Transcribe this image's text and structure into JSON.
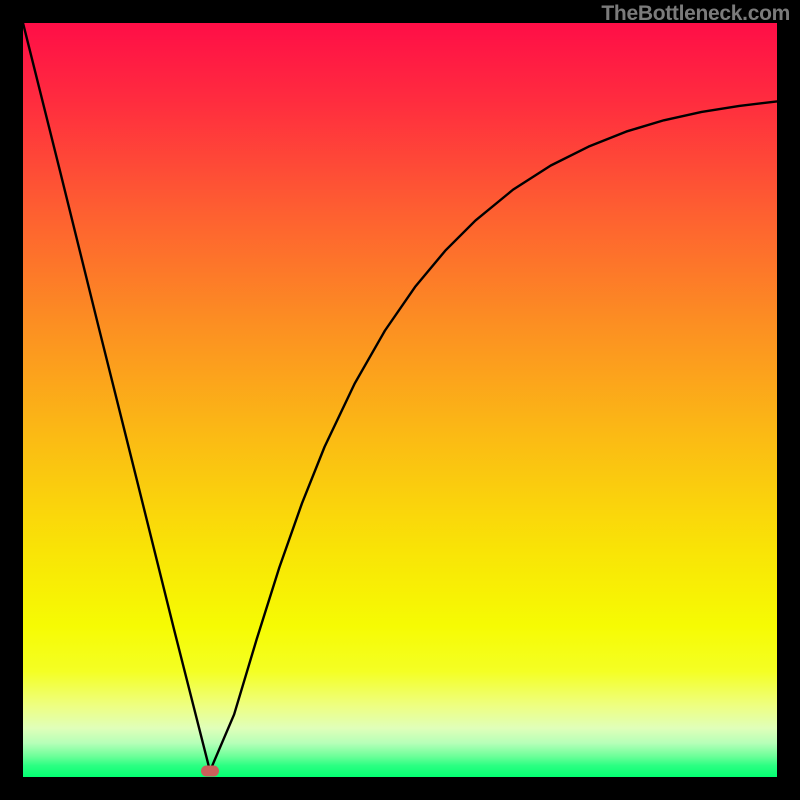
{
  "attribution": "TheBottleneck.com",
  "marker": {
    "color": "#cb5f5b",
    "cx_frac": 0.248,
    "cy_frac": 0.992
  },
  "gradient_stops": [
    {
      "offset": 0.0,
      "color": "#ff0e47"
    },
    {
      "offset": 0.1,
      "color": "#ff2b3f"
    },
    {
      "offset": 0.25,
      "color": "#fe5f31"
    },
    {
      "offset": 0.4,
      "color": "#fc8f22"
    },
    {
      "offset": 0.55,
      "color": "#fbbb14"
    },
    {
      "offset": 0.7,
      "color": "#f9e406"
    },
    {
      "offset": 0.8,
      "color": "#f6fb03"
    },
    {
      "offset": 0.86,
      "color": "#f4ff24"
    },
    {
      "offset": 0.905,
      "color": "#eeff81"
    },
    {
      "offset": 0.935,
      "color": "#e0ffb9"
    },
    {
      "offset": 0.955,
      "color": "#b6ffb8"
    },
    {
      "offset": 0.972,
      "color": "#6fff9a"
    },
    {
      "offset": 0.985,
      "color": "#2bff82"
    },
    {
      "offset": 1.0,
      "color": "#03ff72"
    }
  ],
  "chart_data": {
    "type": "line",
    "title": "",
    "xlabel": "",
    "ylabel": "",
    "xlim": [
      0,
      1
    ],
    "ylim": [
      0,
      1
    ],
    "note": "x/y are fractions of plot width/height; y=0 is bottom (green), y=1 is top (red). Curve dips to ~0 near x≈0.25 then rises asymptotically.",
    "series": [
      {
        "name": "bottleneck-curve",
        "x": [
          0.0,
          0.05,
          0.1,
          0.15,
          0.2,
          0.248,
          0.28,
          0.31,
          0.34,
          0.37,
          0.4,
          0.44,
          0.48,
          0.52,
          0.56,
          0.6,
          0.65,
          0.7,
          0.75,
          0.8,
          0.85,
          0.9,
          0.95,
          1.0
        ],
        "y": [
          1.0,
          0.8,
          0.598,
          0.398,
          0.197,
          0.008,
          0.083,
          0.183,
          0.278,
          0.363,
          0.438,
          0.522,
          0.592,
          0.65,
          0.698,
          0.738,
          0.779,
          0.811,
          0.836,
          0.856,
          0.871,
          0.882,
          0.89,
          0.896
        ]
      }
    ],
    "marker_point": {
      "x": 0.248,
      "y": 0.008
    }
  }
}
